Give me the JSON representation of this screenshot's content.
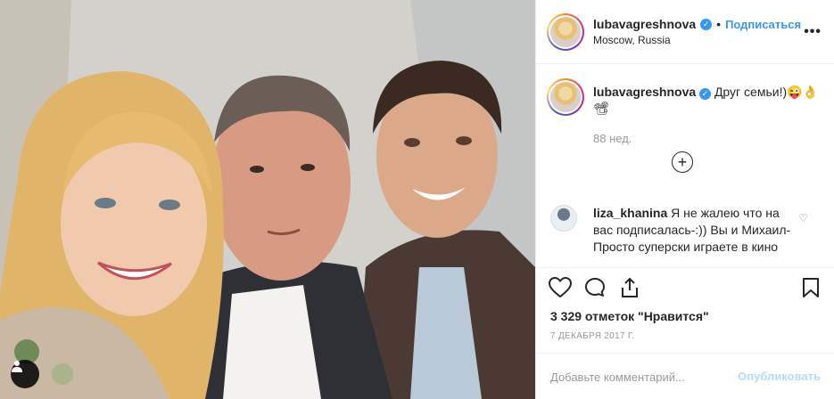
{
  "post": {
    "author": "lubavagreshnova",
    "follow_label": "Подписаться",
    "separator": "•",
    "location": "Moscow, Russia",
    "more_label": "•••",
    "verified_glyph": "✓"
  },
  "caption": {
    "username": "lubavagreshnova",
    "text": "Друг семьи!)😜👌📽",
    "age": "88 нед.",
    "load_more_glyph": "+"
  },
  "comment": {
    "username": "liza_khanina",
    "text": "Я не жалею что на вас подписалась-:)) Вы и Михаил-Просто суперски играете в кино",
    "like_glyph": "♡"
  },
  "stats": {
    "likes": "3 329 отметок \"Нравится\"",
    "date": "7 ДЕКАБРЯ 2017 Г."
  },
  "add_comment": {
    "placeholder": "Добавьте комментарий...",
    "publish_label": "Опубликовать"
  },
  "icons": [
    "heart-icon",
    "comment-icon",
    "share-icon",
    "bookmark-icon",
    "user-tag-icon",
    "more-options-icon",
    "verified-badge-icon",
    "load-more-icon"
  ],
  "colors": {
    "link_blue": "#3897f0",
    "muted": "#999999",
    "text": "#262626",
    "publish_disabled": "#b3dbff"
  }
}
